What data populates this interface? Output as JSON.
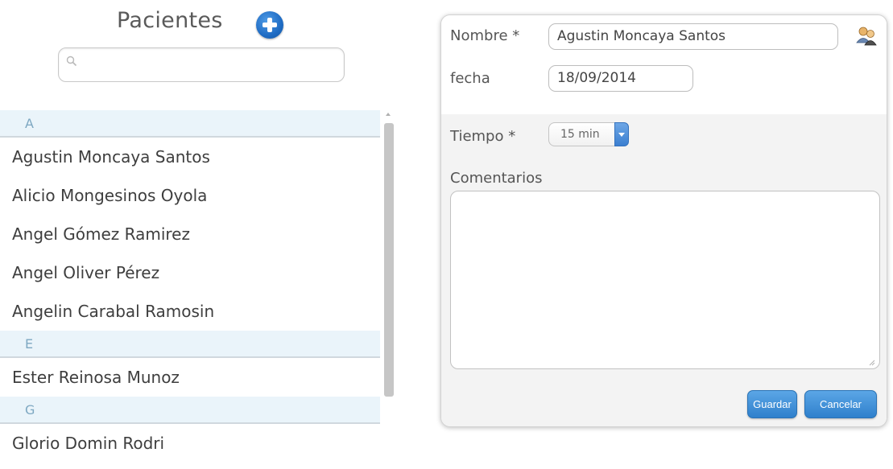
{
  "header": {
    "title": "Pacientes"
  },
  "search": {
    "value": "",
    "placeholder": ""
  },
  "patients": {
    "groups": [
      {
        "letter": "A",
        "items": [
          "Agustin Moncaya Santos",
          "Alicio Mongesinos Oyola",
          "Angel Gómez Ramirez",
          "Angel Oliver Pérez",
          "Angelin Carabal Ramosin"
        ]
      },
      {
        "letter": "E",
        "items": [
          "Ester Reinosa Munoz"
        ]
      },
      {
        "letter": "G",
        "items": [
          "Glorio Domin Rodri"
        ]
      }
    ]
  },
  "form": {
    "name_label": "Nombre *",
    "name_value": "Agustin Moncaya Santos",
    "date_label": "fecha",
    "date_value": "18/09/2014",
    "time_label": "Tiempo *",
    "time_value": "15 min",
    "comments_label": "Comentarios",
    "comments_value": "",
    "save_label": "Guardar",
    "cancel_label": "Cancelar"
  },
  "icons": {
    "add": "plus-circle-icon",
    "search": "search-icon",
    "contact": "user-contacts-icon",
    "dropdown": "caret-down-icon"
  },
  "colors": {
    "accent": "#2f80cc",
    "group_header_bg": "#eaf4fa",
    "group_header_text": "#7ea8c2",
    "form_shade": "#f3f3f3"
  }
}
